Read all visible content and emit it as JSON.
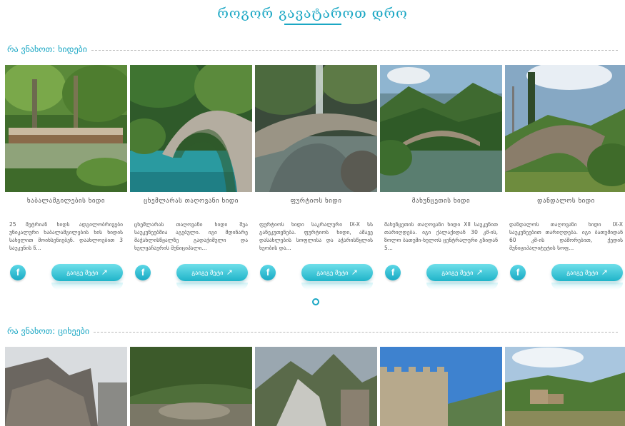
{
  "header": {
    "title": "როგორ გავატაროთ დრო"
  },
  "sections": [
    {
      "label": "რა ვნახოთ: ხიდები",
      "cards": [
        {
          "title": "ხაბალამგილების ხიდი",
          "text": "25 მეტრიან ხიდს ადგილობრივები უნიკალური ხაბალამგილების ხის ხიდის სახელით მოიხსენიებენ. დაახლოებით 3 საუკუნის წ...",
          "more": "გაიგე მეტი",
          "fb": "f"
        },
        {
          "title": "ცხემლარას თაღოვანი ხიდი",
          "text": "ცხემლარას თაღოვანი ხიდი შუა საუკუნეებშია აგებული. იგი მდინარე მაჭახლისწყალზე გადაჭიმული და ხელვაჩაურის მუნიციპალი...",
          "more": "გაიგე მეტი",
          "fb": "f"
        },
        {
          "title": "ფურტიოს ხიდი",
          "text": "ფურტიოს ხიდი საკრალური IX-X სს განეკუთვნება. ფურტიოს ხიდი, აშავე დასახლების სოფლისა და აჭარისწყლის ხეობის და...",
          "more": "გაიგე მეტი",
          "fb": "f"
        },
        {
          "title": "მახუნცეთის ხიდი",
          "text": "მახუნცეთის თაღოვანი ხიდი XII საუკუნით თარიღდება. იგი ქალაქიდან 30 კმ-ის, ზოლო ბათუმი-ხულოს ცენტრალური გზიდან 5...",
          "more": "გაიგე მეტი",
          "fb": "f"
        },
        {
          "title": "დანდალოს ხიდი",
          "text": "დანდალოს თაღოვანი ხიდი IX-X საუკუნეებით თარიღდება. იგი ბათუმიდან 60 კმ-ის დაშორებით, ქედის მუნიციპალიტეტის სოფ...",
          "more": "გაიგე მეტი",
          "fb": "f"
        }
      ]
    },
    {
      "label": "რა ვნახოთ: ციხეები"
    }
  ],
  "colors": {
    "accent": "#1ba7c4",
    "button": "#34c2d4"
  },
  "pager": {
    "current": 1,
    "total": 1
  }
}
